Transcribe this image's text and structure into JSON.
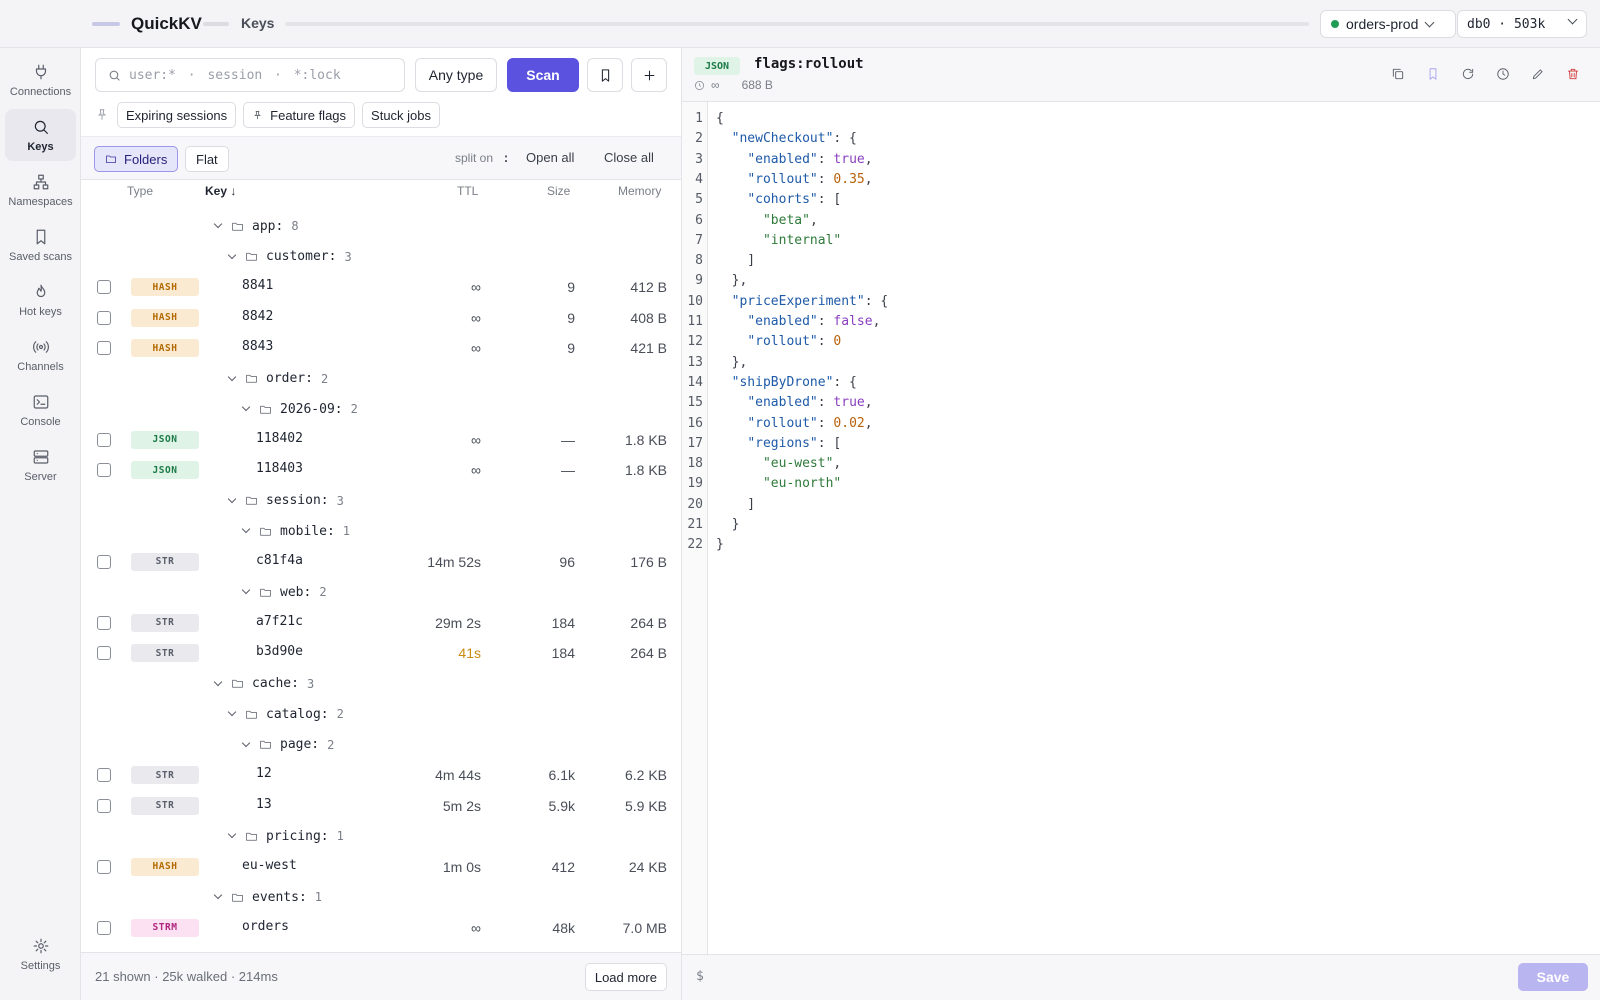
{
  "app": {
    "name": "QuickKV",
    "breadcrumb": "Keys"
  },
  "connection": {
    "name": "orders-prod",
    "status_color": "#1f9d55",
    "db_label": "db0 · 503k"
  },
  "nav": {
    "items": [
      {
        "label": "Connections",
        "icon": "plug-icon"
      },
      {
        "label": "Keys",
        "icon": "search-icon",
        "active": true
      },
      {
        "label": "Namespaces",
        "icon": "sitemap-icon"
      },
      {
        "label": "Saved scans",
        "icon": "bookmark-icon"
      },
      {
        "label": "Hot keys",
        "icon": "flame-icon"
      },
      {
        "label": "Channels",
        "icon": "broadcast-icon"
      },
      {
        "label": "Console",
        "icon": "terminal-icon"
      },
      {
        "label": "Server",
        "icon": "server-icon"
      }
    ],
    "settings_label": "Settings"
  },
  "search": {
    "placeholder": "user:* · session · *:lock",
    "value": ""
  },
  "toolbar": {
    "type_label": "Any type",
    "scan_label": "Scan",
    "accent": "#5b53e0"
  },
  "saved_chips": [
    "Expiring sessions",
    "Feature flags",
    "Stuck jobs"
  ],
  "view": {
    "folders_label": "Folders",
    "flat_label": "Flat",
    "split_label": "split on",
    "split_char": ":",
    "open_all": "Open all",
    "close_all": "Close all"
  },
  "columns": {
    "type": "Type",
    "key": "Key ↓",
    "ttl": "TTL",
    "size": "Size",
    "memory": "Memory"
  },
  "rows": [
    {
      "kind": "folder",
      "depth": 0,
      "name": "app:",
      "count": "8"
    },
    {
      "kind": "folder",
      "depth": 1,
      "name": "customer:",
      "count": "3"
    },
    {
      "kind": "key",
      "depth": 2,
      "type": "HASH",
      "name": "8841",
      "ttl": "∞",
      "size": "9",
      "memory": "412 B"
    },
    {
      "kind": "key",
      "depth": 2,
      "type": "HASH",
      "name": "8842",
      "ttl": "∞",
      "size": "9",
      "memory": "408 B"
    },
    {
      "kind": "key",
      "depth": 2,
      "type": "HASH",
      "name": "8843",
      "ttl": "∞",
      "size": "9",
      "memory": "421 B"
    },
    {
      "kind": "folder",
      "depth": 1,
      "name": "order:",
      "count": "2"
    },
    {
      "kind": "folder",
      "depth": 2,
      "name": "2026-09:",
      "count": "2"
    },
    {
      "kind": "key",
      "depth": 3,
      "type": "JSON",
      "name": "118402",
      "ttl": "∞",
      "size": "—",
      "memory": "1.8 KB"
    },
    {
      "kind": "key",
      "depth": 3,
      "type": "JSON",
      "name": "118403",
      "ttl": "∞",
      "size": "—",
      "memory": "1.8 KB"
    },
    {
      "kind": "folder",
      "depth": 1,
      "name": "session:",
      "count": "3"
    },
    {
      "kind": "folder",
      "depth": 2,
      "name": "mobile:",
      "count": "1"
    },
    {
      "kind": "key",
      "depth": 3,
      "type": "STR",
      "name": "c81f4a",
      "ttl": "14m 52s",
      "size": "96",
      "memory": "176 B"
    },
    {
      "kind": "folder",
      "depth": 2,
      "name": "web:",
      "count": "2"
    },
    {
      "kind": "key",
      "depth": 3,
      "type": "STR",
      "name": "a7f21c",
      "ttl": "29m 2s",
      "size": "184",
      "memory": "264 B"
    },
    {
      "kind": "key",
      "depth": 3,
      "type": "STR",
      "name": "b3d90e",
      "ttl": "41s",
      "size": "184",
      "memory": "264 B",
      "warn": true
    },
    {
      "kind": "folder",
      "depth": 0,
      "name": "cache:",
      "count": "3"
    },
    {
      "kind": "folder",
      "depth": 1,
      "name": "catalog:",
      "count": "2"
    },
    {
      "kind": "folder",
      "depth": 2,
      "name": "page:",
      "count": "2"
    },
    {
      "kind": "key",
      "depth": 3,
      "type": "STR",
      "name": "12",
      "ttl": "4m 44s",
      "size": "6.1k",
      "memory": "6.2 KB"
    },
    {
      "kind": "key",
      "depth": 3,
      "type": "STR",
      "name": "13",
      "ttl": "5m 2s",
      "size": "5.9k",
      "memory": "5.9 KB"
    },
    {
      "kind": "folder",
      "depth": 1,
      "name": "pricing:",
      "count": "1"
    },
    {
      "kind": "key",
      "depth": 2,
      "type": "HASH",
      "name": "eu-west",
      "ttl": "1m 0s",
      "size": "412",
      "memory": "24 KB"
    },
    {
      "kind": "folder",
      "depth": 0,
      "name": "events:",
      "count": "1"
    },
    {
      "kind": "key",
      "depth": 2,
      "type": "STRM",
      "name": "orders",
      "ttl": "∞",
      "size": "48k",
      "memory": "7.0 MB"
    }
  ],
  "type_colors": {
    "HASH": {
      "bg": "#fbead2",
      "fg": "#b26a00"
    },
    "JSON": {
      "bg": "#dff3e7",
      "fg": "#1b7a46"
    },
    "STR": {
      "bg": "#e9e9ee",
      "fg": "#5a5e6a"
    },
    "STRM": {
      "bg": "#fbe1f1",
      "fg": "#b0247e"
    }
  },
  "footer": {
    "status": "21 shown · 25k walked · 214ms",
    "load_more": "Load more"
  },
  "viewer": {
    "type": "JSON",
    "key": "flags:rollout",
    "ttl": "∞",
    "size": "688 B",
    "save_label": "Save",
    "prompt": "$",
    "lines": [
      [
        [
          "p",
          "{"
        ]
      ],
      [
        [
          "p",
          "  "
        ],
        [
          "k",
          "\"newCheckout\""
        ],
        [
          "p",
          ": {"
        ]
      ],
      [
        [
          "p",
          "    "
        ],
        [
          "k",
          "\"enabled\""
        ],
        [
          "p",
          ": "
        ],
        [
          "b",
          "true"
        ],
        [
          "p",
          ","
        ]
      ],
      [
        [
          "p",
          "    "
        ],
        [
          "k",
          "\"rollout\""
        ],
        [
          "p",
          ": "
        ],
        [
          "n",
          "0.35"
        ],
        [
          "p",
          ","
        ]
      ],
      [
        [
          "p",
          "    "
        ],
        [
          "k",
          "\"cohorts\""
        ],
        [
          "p",
          ": ["
        ]
      ],
      [
        [
          "p",
          "      "
        ],
        [
          "s",
          "\"beta\""
        ],
        [
          "p",
          ","
        ]
      ],
      [
        [
          "p",
          "      "
        ],
        [
          "s",
          "\"internal\""
        ]
      ],
      [
        [
          "p",
          "    ]"
        ]
      ],
      [
        [
          "p",
          "  },"
        ]
      ],
      [
        [
          "p",
          "  "
        ],
        [
          "k",
          "\"priceExperiment\""
        ],
        [
          "p",
          ": {"
        ]
      ],
      [
        [
          "p",
          "    "
        ],
        [
          "k",
          "\"enabled\""
        ],
        [
          "p",
          ": "
        ],
        [
          "b",
          "false"
        ],
        [
          "p",
          ","
        ]
      ],
      [
        [
          "p",
          "    "
        ],
        [
          "k",
          "\"rollout\""
        ],
        [
          "p",
          ": "
        ],
        [
          "n",
          "0"
        ]
      ],
      [
        [
          "p",
          "  },"
        ]
      ],
      [
        [
          "p",
          "  "
        ],
        [
          "k",
          "\"shipByDrone\""
        ],
        [
          "p",
          ": {"
        ]
      ],
      [
        [
          "p",
          "    "
        ],
        [
          "k",
          "\"enabled\""
        ],
        [
          "p",
          ": "
        ],
        [
          "b",
          "true"
        ],
        [
          "p",
          ","
        ]
      ],
      [
        [
          "p",
          "    "
        ],
        [
          "k",
          "\"rollout\""
        ],
        [
          "p",
          ": "
        ],
        [
          "n",
          "0.02"
        ],
        [
          "p",
          ","
        ]
      ],
      [
        [
          "p",
          "    "
        ],
        [
          "k",
          "\"regions\""
        ],
        [
          "p",
          ": ["
        ]
      ],
      [
        [
          "p",
          "      "
        ],
        [
          "s",
          "\"eu-west\""
        ],
        [
          "p",
          ","
        ]
      ],
      [
        [
          "p",
          "      "
        ],
        [
          "s",
          "\"eu-north\""
        ]
      ],
      [
        [
          "p",
          "    ]"
        ]
      ],
      [
        [
          "p",
          "  }"
        ]
      ],
      [
        [
          "p",
          "}"
        ]
      ]
    ]
  }
}
